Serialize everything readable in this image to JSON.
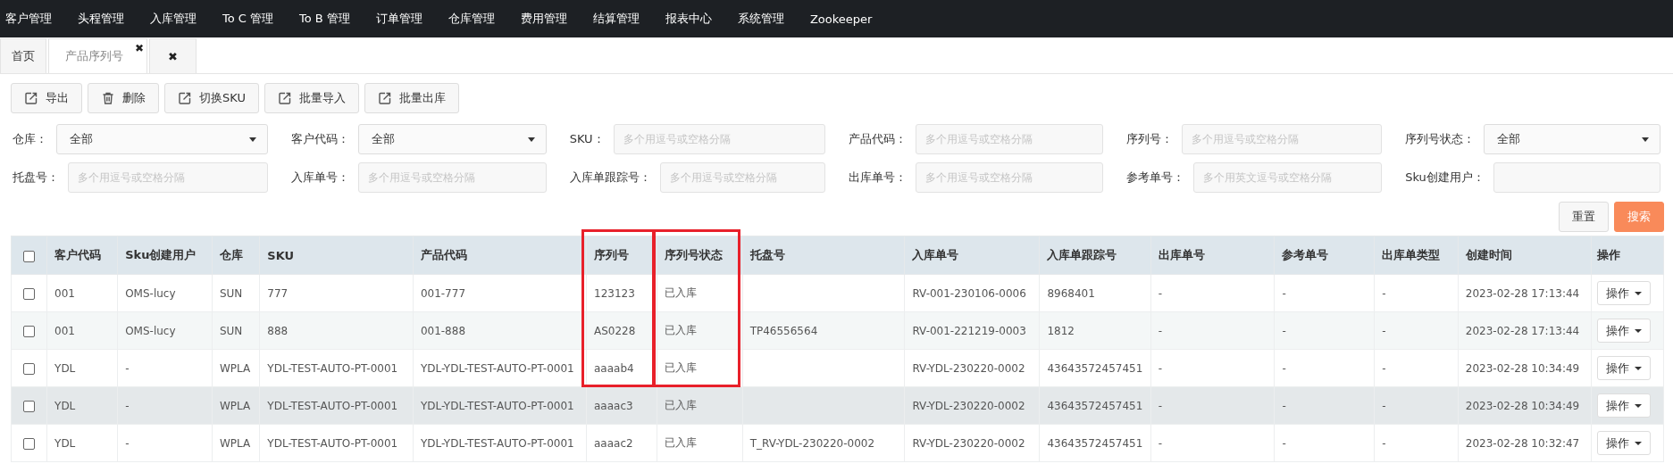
{
  "nav": {
    "items": [
      {
        "label": "客户管理"
      },
      {
        "label": "头程管理"
      },
      {
        "label": "入库管理"
      },
      {
        "label": "To C 管理"
      },
      {
        "label": "To B 管理"
      },
      {
        "label": "订单管理"
      },
      {
        "label": "仓库管理"
      },
      {
        "label": "费用管理"
      },
      {
        "label": "结算管理"
      },
      {
        "label": "报表中心"
      },
      {
        "label": "系统管理"
      },
      {
        "label": "Zookeeper"
      }
    ]
  },
  "tabs": [
    {
      "kind": "page",
      "label": "首页",
      "selected": false
    },
    {
      "kind": "page",
      "label": "产品序列号",
      "selected": true,
      "close_label": "✖"
    },
    {
      "kind": "close-all",
      "label": "✖",
      "selected": false
    }
  ],
  "toolbar": [
    {
      "kind": "share",
      "label": "导出"
    },
    {
      "kind": "trash",
      "label": "删除"
    },
    {
      "kind": "share",
      "label": "切换SKU"
    },
    {
      "kind": "share",
      "label": "批量导入"
    },
    {
      "kind": "share",
      "label": "批量出库"
    }
  ],
  "filters": [
    {
      "label": "仓库：",
      "kind": "select",
      "value": "全部"
    },
    {
      "label": "客户代码：",
      "kind": "select",
      "value": "全部"
    },
    {
      "label": "SKU：",
      "kind": "input",
      "placeholder": "多个用逗号或空格分隔"
    },
    {
      "label": "产品代码：",
      "kind": "input",
      "placeholder": "多个用逗号或空格分隔"
    },
    {
      "label": "序列号：",
      "kind": "input",
      "placeholder": "多个用逗号或空格分隔"
    },
    {
      "label": "序列号状态：",
      "kind": "select",
      "value": "全部"
    },
    {
      "label": "托盘号：",
      "kind": "input",
      "placeholder": "多个用逗号或空格分隔"
    },
    {
      "label": "入库单号：",
      "kind": "input",
      "placeholder": "多个用逗号或空格分隔"
    },
    {
      "label": "入库单跟踪号：",
      "kind": "input",
      "placeholder": "多个用逗号或空格分隔"
    },
    {
      "label": "出库单号：",
      "kind": "input",
      "placeholder": "多个用逗号或空格分隔"
    },
    {
      "label": "参考单号：",
      "kind": "input",
      "placeholder": "多个用英文逗号或空格分隔"
    },
    {
      "label": "Sku创建用户：",
      "kind": "input"
    }
  ],
  "actions": [
    {
      "kind": "reset",
      "label": "重置"
    },
    {
      "kind": "search",
      "label": "搜索"
    }
  ],
  "table": {
    "select_all_checked": false,
    "columns": [
      {
        "label": "客户代码",
        "annotated": false
      },
      {
        "label": "Sku创建用户",
        "annotated": false
      },
      {
        "label": "仓库",
        "annotated": false
      },
      {
        "label": "SKU",
        "annotated": false
      },
      {
        "label": "产品代码",
        "annotated": false
      },
      {
        "label": "序列号",
        "annotated": true
      },
      {
        "label": "序列号状态",
        "annotated": true
      },
      {
        "label": "托盘号",
        "annotated": false
      },
      {
        "label": "入库单号",
        "annotated": false
      },
      {
        "label": "入库单跟踪号",
        "annotated": false
      },
      {
        "label": "出库单号",
        "annotated": false
      },
      {
        "label": "参考单号",
        "annotated": false
      },
      {
        "label": "出库单类型",
        "annotated": false
      },
      {
        "label": "创建时间",
        "annotated": false
      },
      {
        "label": "操作",
        "annotated": false
      }
    ],
    "rows": [
      {
        "checked": false,
        "hovered": false,
        "annotated": true,
        "cells": [
          "001",
          "OMS-lucy",
          "SUN",
          "777",
          "001-777",
          "123123",
          "已入库",
          "",
          "RV-001-230106-0006",
          "8968401",
          "-",
          "-",
          "-",
          "2023-02-28 17:13:44"
        ],
        "action": "操作"
      },
      {
        "checked": false,
        "hovered": false,
        "annotated": true,
        "cells": [
          "001",
          "OMS-lucy",
          "SUN",
          "888",
          "001-888",
          "AS0228",
          "已入库",
          "TP46556564",
          "RV-001-221219-0003",
          "1812",
          "-",
          "-",
          "-",
          "2023-02-28 17:13:44"
        ],
        "action": "操作"
      },
      {
        "checked": false,
        "hovered": false,
        "annotated": true,
        "cells": [
          "YDL",
          "-",
          "WPLA",
          "YDL-TEST-AUTO-PT-0001",
          "YDL-YDL-TEST-AUTO-PT-0001",
          "aaaab4",
          "已入库",
          "",
          "RV-YDL-230220-0002",
          "43643572457451",
          "-",
          "-",
          "-",
          "2023-02-28 10:34:49"
        ],
        "action": "操作"
      },
      {
        "checked": false,
        "hovered": true,
        "annotated": false,
        "cells": [
          "YDL",
          "-",
          "WPLA",
          "YDL-TEST-AUTO-PT-0001",
          "YDL-YDL-TEST-AUTO-PT-0001",
          "aaaac3",
          "已入库",
          "",
          "RV-YDL-230220-0002",
          "43643572457451",
          "-",
          "-",
          "-",
          "2023-02-28 10:34:49"
        ],
        "action": "操作"
      },
      {
        "checked": false,
        "hovered": false,
        "annotated": false,
        "cells": [
          "YDL",
          "-",
          "WPLA",
          "YDL-TEST-AUTO-PT-0001",
          "YDL-YDL-TEST-AUTO-PT-0001",
          "aaaac2",
          "已入库",
          "T_RV-YDL-230220-0002",
          "RV-YDL-230220-0002",
          "43643572457451",
          "-",
          "-",
          "-",
          "2023-02-28 10:32:47"
        ],
        "action": "操作"
      }
    ]
  }
}
